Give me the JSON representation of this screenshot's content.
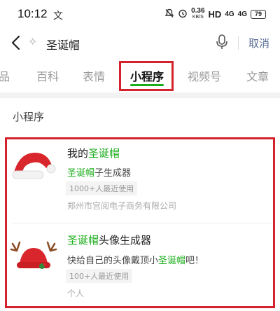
{
  "status_bar": {
    "time": "10:12",
    "left_icon": "文",
    "net_speed": "0.36",
    "net_unit": "KB/S",
    "hd": "HD",
    "signal1": "4G",
    "signal2": "4G",
    "battery": "79"
  },
  "search": {
    "query": "圣诞帽",
    "cancel_label": "取消"
  },
  "tabs": [
    {
      "label": "品"
    },
    {
      "label": "百科"
    },
    {
      "label": "表情"
    },
    {
      "label": "小程序"
    },
    {
      "label": "视频号"
    },
    {
      "label": "文章"
    }
  ],
  "section_title": "小程序",
  "results": [
    {
      "title_prefix": "我的",
      "title_highlight": "圣诞帽",
      "title_suffix": "",
      "subtitle_highlight": "圣诞帽",
      "subtitle_suffix": "子生成器",
      "badge": "1000+人最近使用",
      "owner": "郑州市宫阅电子商务有限公司"
    },
    {
      "title_prefix": "",
      "title_highlight": "圣诞帽",
      "title_suffix": "头像生成器",
      "subtitle_prefix": "快给自己的头像戴顶小",
      "subtitle_highlight": "圣诞帽",
      "subtitle_suffix": "吧！",
      "badge": "100+人最近使用",
      "owner": "个人"
    }
  ],
  "colors": {
    "accent_green": "#1aad19",
    "cancel_blue": "#576b95",
    "annotation_red": "#d4232d"
  }
}
